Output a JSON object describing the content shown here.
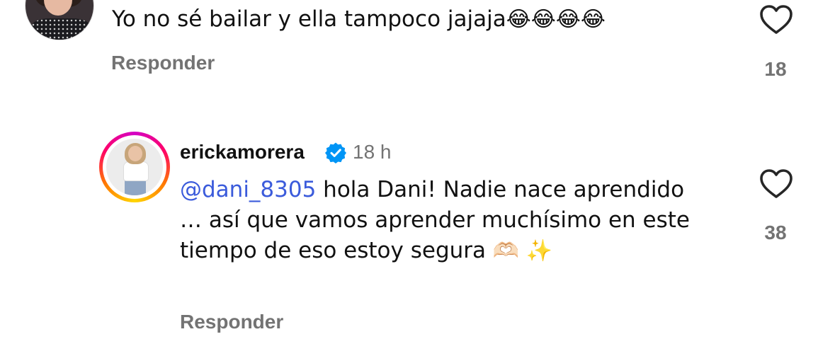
{
  "comments": [
    {
      "avatar": "user-avatar-photo",
      "text": "Yo no sé bailar y ella tampoco jajaja",
      "emojis": "😂😂😂😂",
      "reply_label": "Responder",
      "likes": "18"
    },
    {
      "avatar": "ericka-avatar-photo",
      "username": "erickamorera",
      "verified": true,
      "time": "18 h",
      "mention": "@dani_8305",
      "text": " hola Dani! Nadie nace aprendido … así que vamos aprender muchísimo en este tiempo de eso estoy segura ",
      "emojis": "🫶🏻 ✨",
      "reply_label": "Responder",
      "likes": "38"
    }
  ],
  "colors": {
    "text": "#111111",
    "muted": "#737373",
    "mention": "#3b5bdb",
    "verified": "#0095f6",
    "story_ring_start": "#d300c5",
    "story_ring_end": "#ffd600"
  },
  "icons": {
    "like": "heart-outline-icon",
    "verified": "verified-badge-icon"
  }
}
